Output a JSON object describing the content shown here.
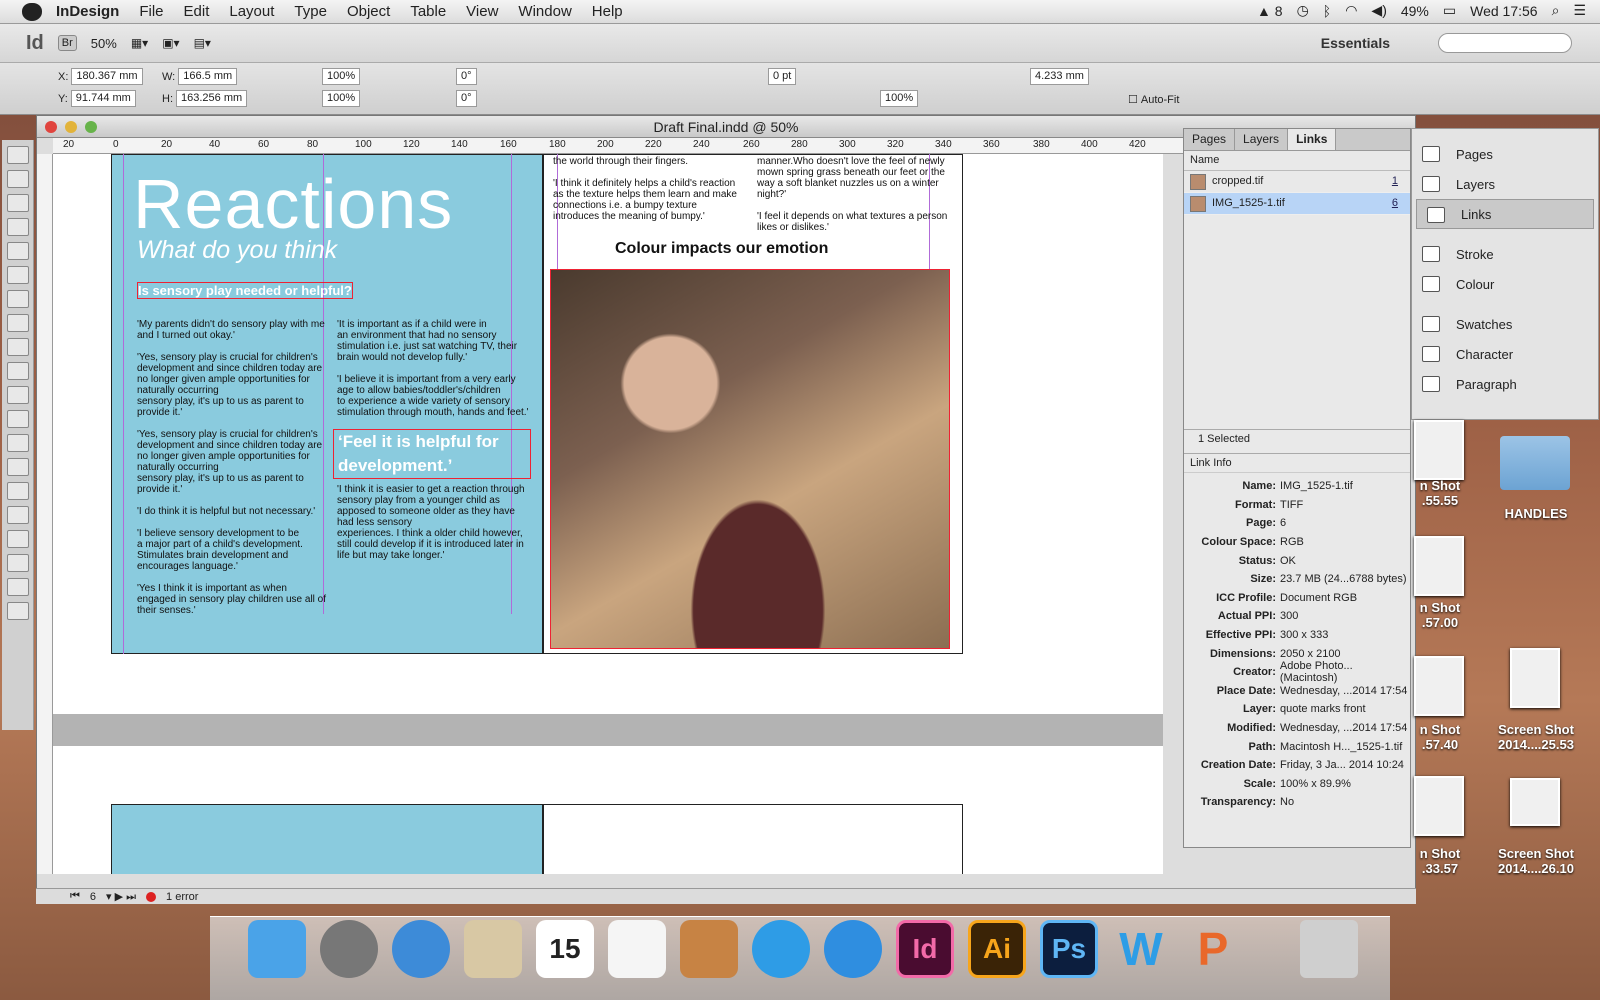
{
  "menubar": {
    "app": "InDesign",
    "items": [
      "File",
      "Edit",
      "Layout",
      "Type",
      "Object",
      "Table",
      "View",
      "Window",
      "Help"
    ],
    "status_num": "8",
    "battery": "49%",
    "clock": "Wed 17:56"
  },
  "control": {
    "logo": "Id",
    "bridge": "Br",
    "zoom": "50%",
    "workspace": "Essentials"
  },
  "props": {
    "x": "180.367 mm",
    "y": "91.744 mm",
    "w": "166.5 mm",
    "h": "163.256 mm",
    "sx": "100%",
    "sy": "100%",
    "rot": "0°",
    "shear": "0°",
    "stroke": "0 pt",
    "opacity": "100%",
    "offset": "4.233 mm",
    "autofit": "Auto-Fit"
  },
  "doc": {
    "title": "Draft Final.indd @ 50%",
    "ruler": [
      "20",
      "0",
      "20",
      "40",
      "60",
      "80",
      "100",
      "120",
      "140",
      "160",
      "180",
      "200",
      "220",
      "240",
      "260",
      "280",
      "300",
      "320",
      "340",
      "360",
      "380",
      "400",
      "420"
    ]
  },
  "page": {
    "heading": "Reactions",
    "subheading": "What do you think",
    "question": "Is sensory play needed or helpful?",
    "col1": "'My parents didn't do sensory play with me and I turned out okay.'\n\n'Yes, sensory play is crucial for children's development and since children today are no longer given ample opportunities for naturally occurring\nsensory play, it's up to us as parent to provide it.'\n\n'Yes, sensory play is crucial for children's development and since children today are no longer given ample opportunities for naturally occurring\nsensory play, it's up to us as parent to provide it.'\n\n'I do think it is helpful but not necessary.'\n\n'I believe sensory development to be\na major part of a child's development. Stimulates brain development and encourages language.'\n\n'Yes I think it is important as when engaged in sensory play children use all of their senses.'",
    "col2a": "'It is important as if a child were in\nan environment that had no sensory stimulation i.e. just sat watching TV, their brain would not develop fully.'\n\n'I believe it is important from a very early age to allow babies/toddler's/children\nto experience a wide variety of sensory stimulation through mouth, hands and feet.'",
    "pullquote": "‘Feel it is helpful for development.’",
    "col2b": "'I think it is easier to get a reaction through sensory play from a younger child as apposed to someone older as they have had less sensory\nexperiences. I think a older child however, still could develop if it is introduced later in life but may take longer.'",
    "r1": "the world through their fingers.\n\n'I think it definitely helps a child's reaction as the texture helps them learn and make connections i.e. a bumpy texture introduces the meaning of bumpy.'",
    "r2": "manner.Who doesn't love the feel of newly mown spring grass beneath our feet or the way a soft blanket nuzzles us on a winter night?'\n\n'I feel it depends on what textures a person likes or dislikes.'",
    "rheading": "Colour impacts our emotion"
  },
  "links": {
    "tabs": [
      "Pages",
      "Layers",
      "Links"
    ],
    "col_name": "Name",
    "rows": [
      {
        "name": "cropped.tif",
        "page": "1"
      },
      {
        "name": "IMG_1525-1.tif",
        "page": "6"
      }
    ],
    "selected": "1 Selected",
    "info_title": "Link Info",
    "info": [
      [
        "Name:",
        "IMG_1525-1.tif"
      ],
      [
        "Format:",
        "TIFF"
      ],
      [
        "Page:",
        "6"
      ],
      [
        "Colour Space:",
        "RGB"
      ],
      [
        "Status:",
        "OK"
      ],
      [
        "Size:",
        "23.7 MB (24...6788 bytes)"
      ],
      [
        "ICC Profile:",
        "Document RGB"
      ],
      [
        "Actual PPI:",
        "300"
      ],
      [
        "Effective PPI:",
        "300 x 333"
      ],
      [
        "Dimensions:",
        "2050 x 2100"
      ],
      [
        "Creator:",
        "Adobe Photo...(Macintosh)"
      ],
      [
        "Place Date:",
        "Wednesday, ...2014 17:54"
      ],
      [
        "Layer:",
        "quote marks front"
      ],
      [
        "Modified:",
        "Wednesday, ...2014 17:54"
      ],
      [
        "Path:",
        "Macintosh H..._1525-1.tif"
      ],
      [
        "Creation Date:",
        "Friday, 3 Ja... 2014 10:24"
      ],
      [
        "Scale:",
        "100% x 89.9%"
      ],
      [
        "Transparency:",
        "No"
      ]
    ]
  },
  "dockpanel": {
    "items": [
      "Pages",
      "Layers",
      "Links",
      "Stroke",
      "Colour",
      "Swatches",
      "Character",
      "Paragraph"
    ]
  },
  "desktop": {
    "folder": "HANDLES",
    "s1": "n Shot\n.55.55",
    "s2": "n Shot\n.57.00",
    "s3": "n Shot\n.57.40",
    "s4": "Screen Shot\n2014....25.53",
    "s5": "n Shot\n.33.57",
    "s6": "Screen Shot\n2014....26.10"
  },
  "status": {
    "page": "6",
    "error": "1 error"
  },
  "dock": {
    "apps": [
      "Finder",
      "Launchpad",
      "Safari",
      "Mail",
      "15",
      "Reminders",
      "iPhoto",
      "iTunes",
      "App Store",
      "Id",
      "Ai",
      "Ps",
      "W",
      "P",
      "Trash"
    ]
  }
}
